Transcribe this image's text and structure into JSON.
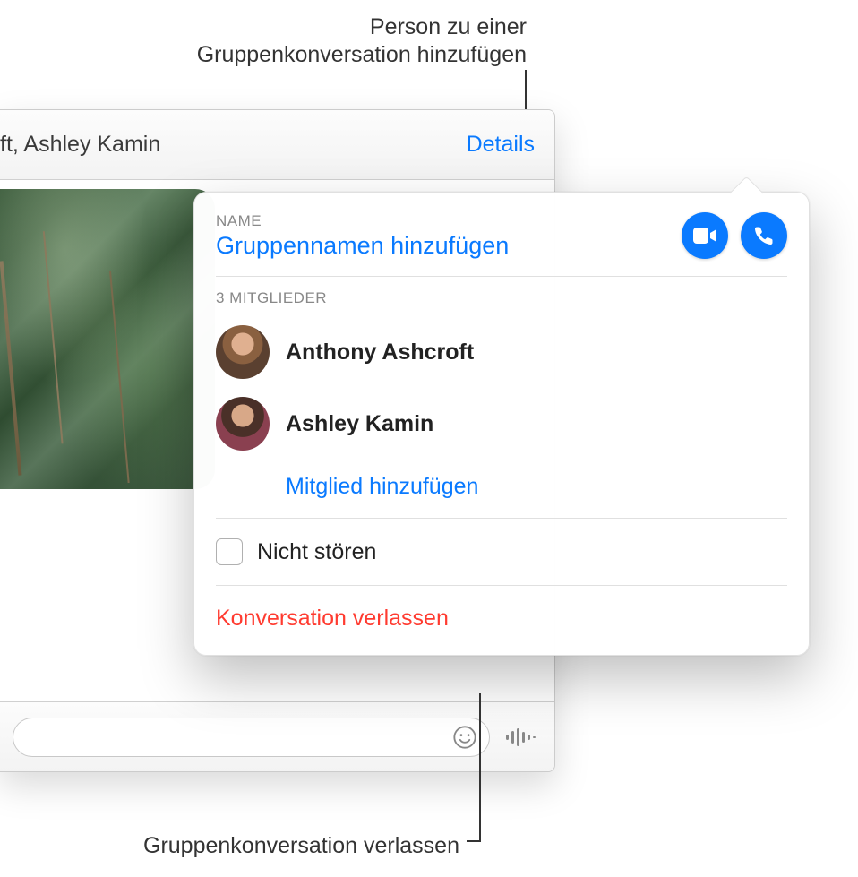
{
  "callouts": {
    "top": "Person zu einer\nGruppenkonversation hinzufügen",
    "bottom": "Gruppenkonversation verlassen"
  },
  "header": {
    "names": "ft, Ashley Kamin",
    "details": "Details"
  },
  "popover": {
    "name_label": "Name",
    "name_placeholder": "Gruppennamen hinzufügen",
    "members_label": "3 MITGLIEDER",
    "members": [
      {
        "name": "Anthony Ashcroft"
      },
      {
        "name": "Ashley Kamin"
      }
    ],
    "add_member": "Mitglied hinzufügen",
    "dnd": "Nicht stören",
    "leave": "Konversation verlassen"
  },
  "icons": {
    "video": "video-icon",
    "phone": "phone-icon",
    "emoji": "emoji-icon",
    "audio": "audio-icon"
  }
}
